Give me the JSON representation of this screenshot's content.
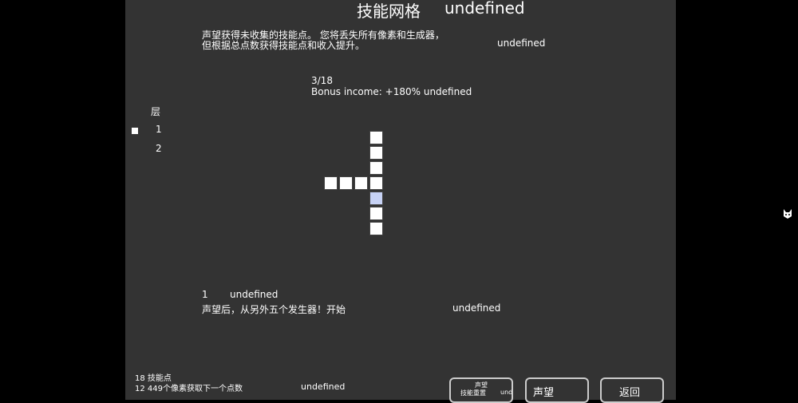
{
  "header": {
    "title": "技能网格",
    "title_suffix": "undefined"
  },
  "description": {
    "line1": "声望获得未收集的技能点。 您将丢失所有像素和生成器，",
    "line2": "但根据总点数获得技能点和收入提升。",
    "extra": "undefined"
  },
  "grid_info": {
    "progress": "3/18",
    "bonus": "Bonus income: +180% undefined"
  },
  "layers": {
    "heading": "层",
    "items": [
      "1",
      "2"
    ],
    "selected": "1"
  },
  "selected_node": {
    "number": "1",
    "title": "undefined",
    "description": "声望后，从另外五个发生器！开始",
    "extra": "undefined"
  },
  "footer": {
    "points": "18 技能点",
    "next_point": "12 449个像素获取下一个点数",
    "extra": "undefined"
  },
  "buttons": {
    "reset_line1": "声望",
    "reset_line2": "技能重置",
    "reset_extra": "und",
    "prestige": "声望",
    "back": "返回"
  },
  "colors": {
    "panel": "#333333",
    "background": "#000000",
    "selected_cell": "#c7d2f5"
  },
  "icons": {
    "edge": "cat-icon"
  }
}
